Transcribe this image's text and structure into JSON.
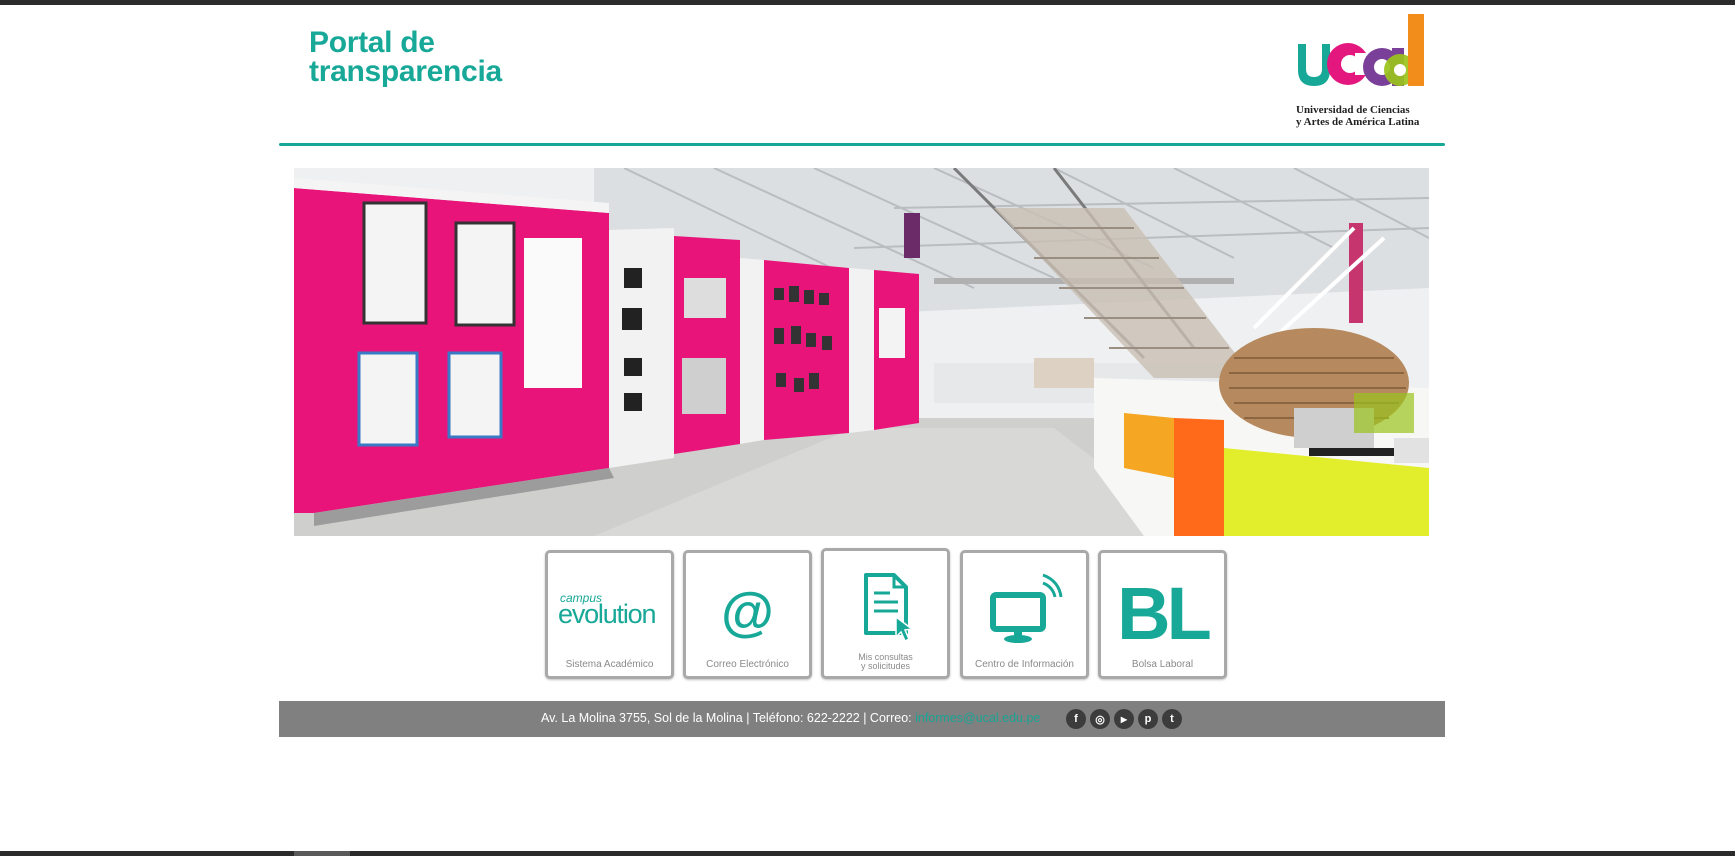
{
  "header": {
    "title_line1": "Portal de",
    "title_line2": "transparencia",
    "logo_name": "ucal",
    "logo_line1": "Universidad de Ciencias",
    "logo_line2": "y Artes de América Latina"
  },
  "tiles": [
    {
      "small": "campus",
      "big": "evolution",
      "label": "Sistema Académico"
    },
    {
      "glyph": "@",
      "label": "Correo Electrónico"
    },
    {
      "label_line1": "Mis consultas",
      "label_line2": "y solicitudes"
    },
    {
      "label": "Centro de Información"
    },
    {
      "glyph": "BL",
      "label": "Bolsa Laboral"
    }
  ],
  "footer": {
    "address": "Av. La Molina 3755, Sol de la Molina | Teléfono: 622-2222 | Correo: ",
    "email": "informes@ucal.edu.pe"
  },
  "socials": [
    {
      "icon": "facebook-icon",
      "glyph": "f"
    },
    {
      "icon": "instagram-icon",
      "glyph": "◎"
    },
    {
      "icon": "youtube-icon",
      "glyph": "▶"
    },
    {
      "icon": "pinterest-icon",
      "glyph": "p"
    },
    {
      "icon": "twitter-icon",
      "glyph": "t"
    }
  ],
  "colors": {
    "brand_teal": "#17a898",
    "footer_gray": "#808080",
    "tile_border": "#a9a9a9"
  }
}
